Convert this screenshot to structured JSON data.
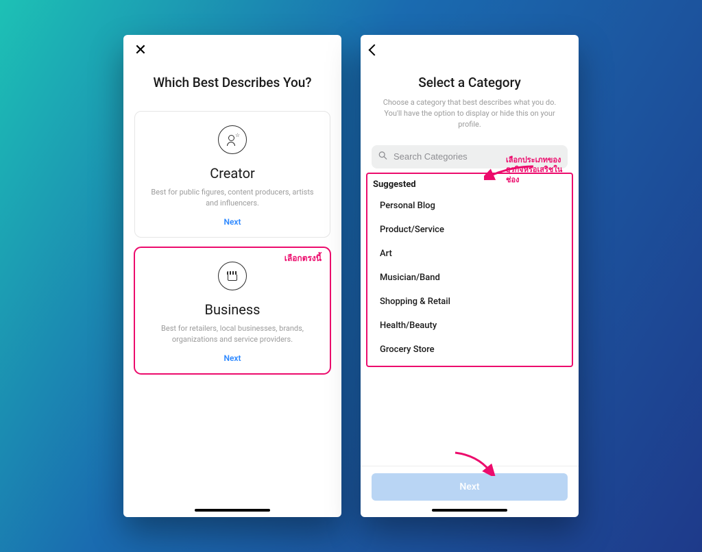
{
  "screen1": {
    "title": "Which Best Describes You?",
    "cards": [
      {
        "title": "Creator",
        "desc": "Best for public figures, content producers, artists and influencers.",
        "next": "Next"
      },
      {
        "title": "Business",
        "desc": "Best for retailers, local businesses, brands, organizations and service providers.",
        "next": "Next"
      }
    ],
    "annotation": "เลือกตรงนี้"
  },
  "screen2": {
    "title": "Select a Category",
    "subtitle": "Choose a category that best describes what you do. You'll have the option to display or hide this on your profile.",
    "search_placeholder": "Search Categories",
    "suggested_label": "Suggested",
    "suggested": [
      "Personal Blog",
      "Product/Service",
      "Art",
      "Musician/Band",
      "Shopping & Retail",
      "Health/Beauty",
      "Grocery Store"
    ],
    "next": "Next",
    "annotation_search": "เลือกประเภทของธุรกิจหรือเสริชในช่อง"
  },
  "colors": {
    "highlight": "#ec0b6c",
    "link": "#2d88ff"
  }
}
